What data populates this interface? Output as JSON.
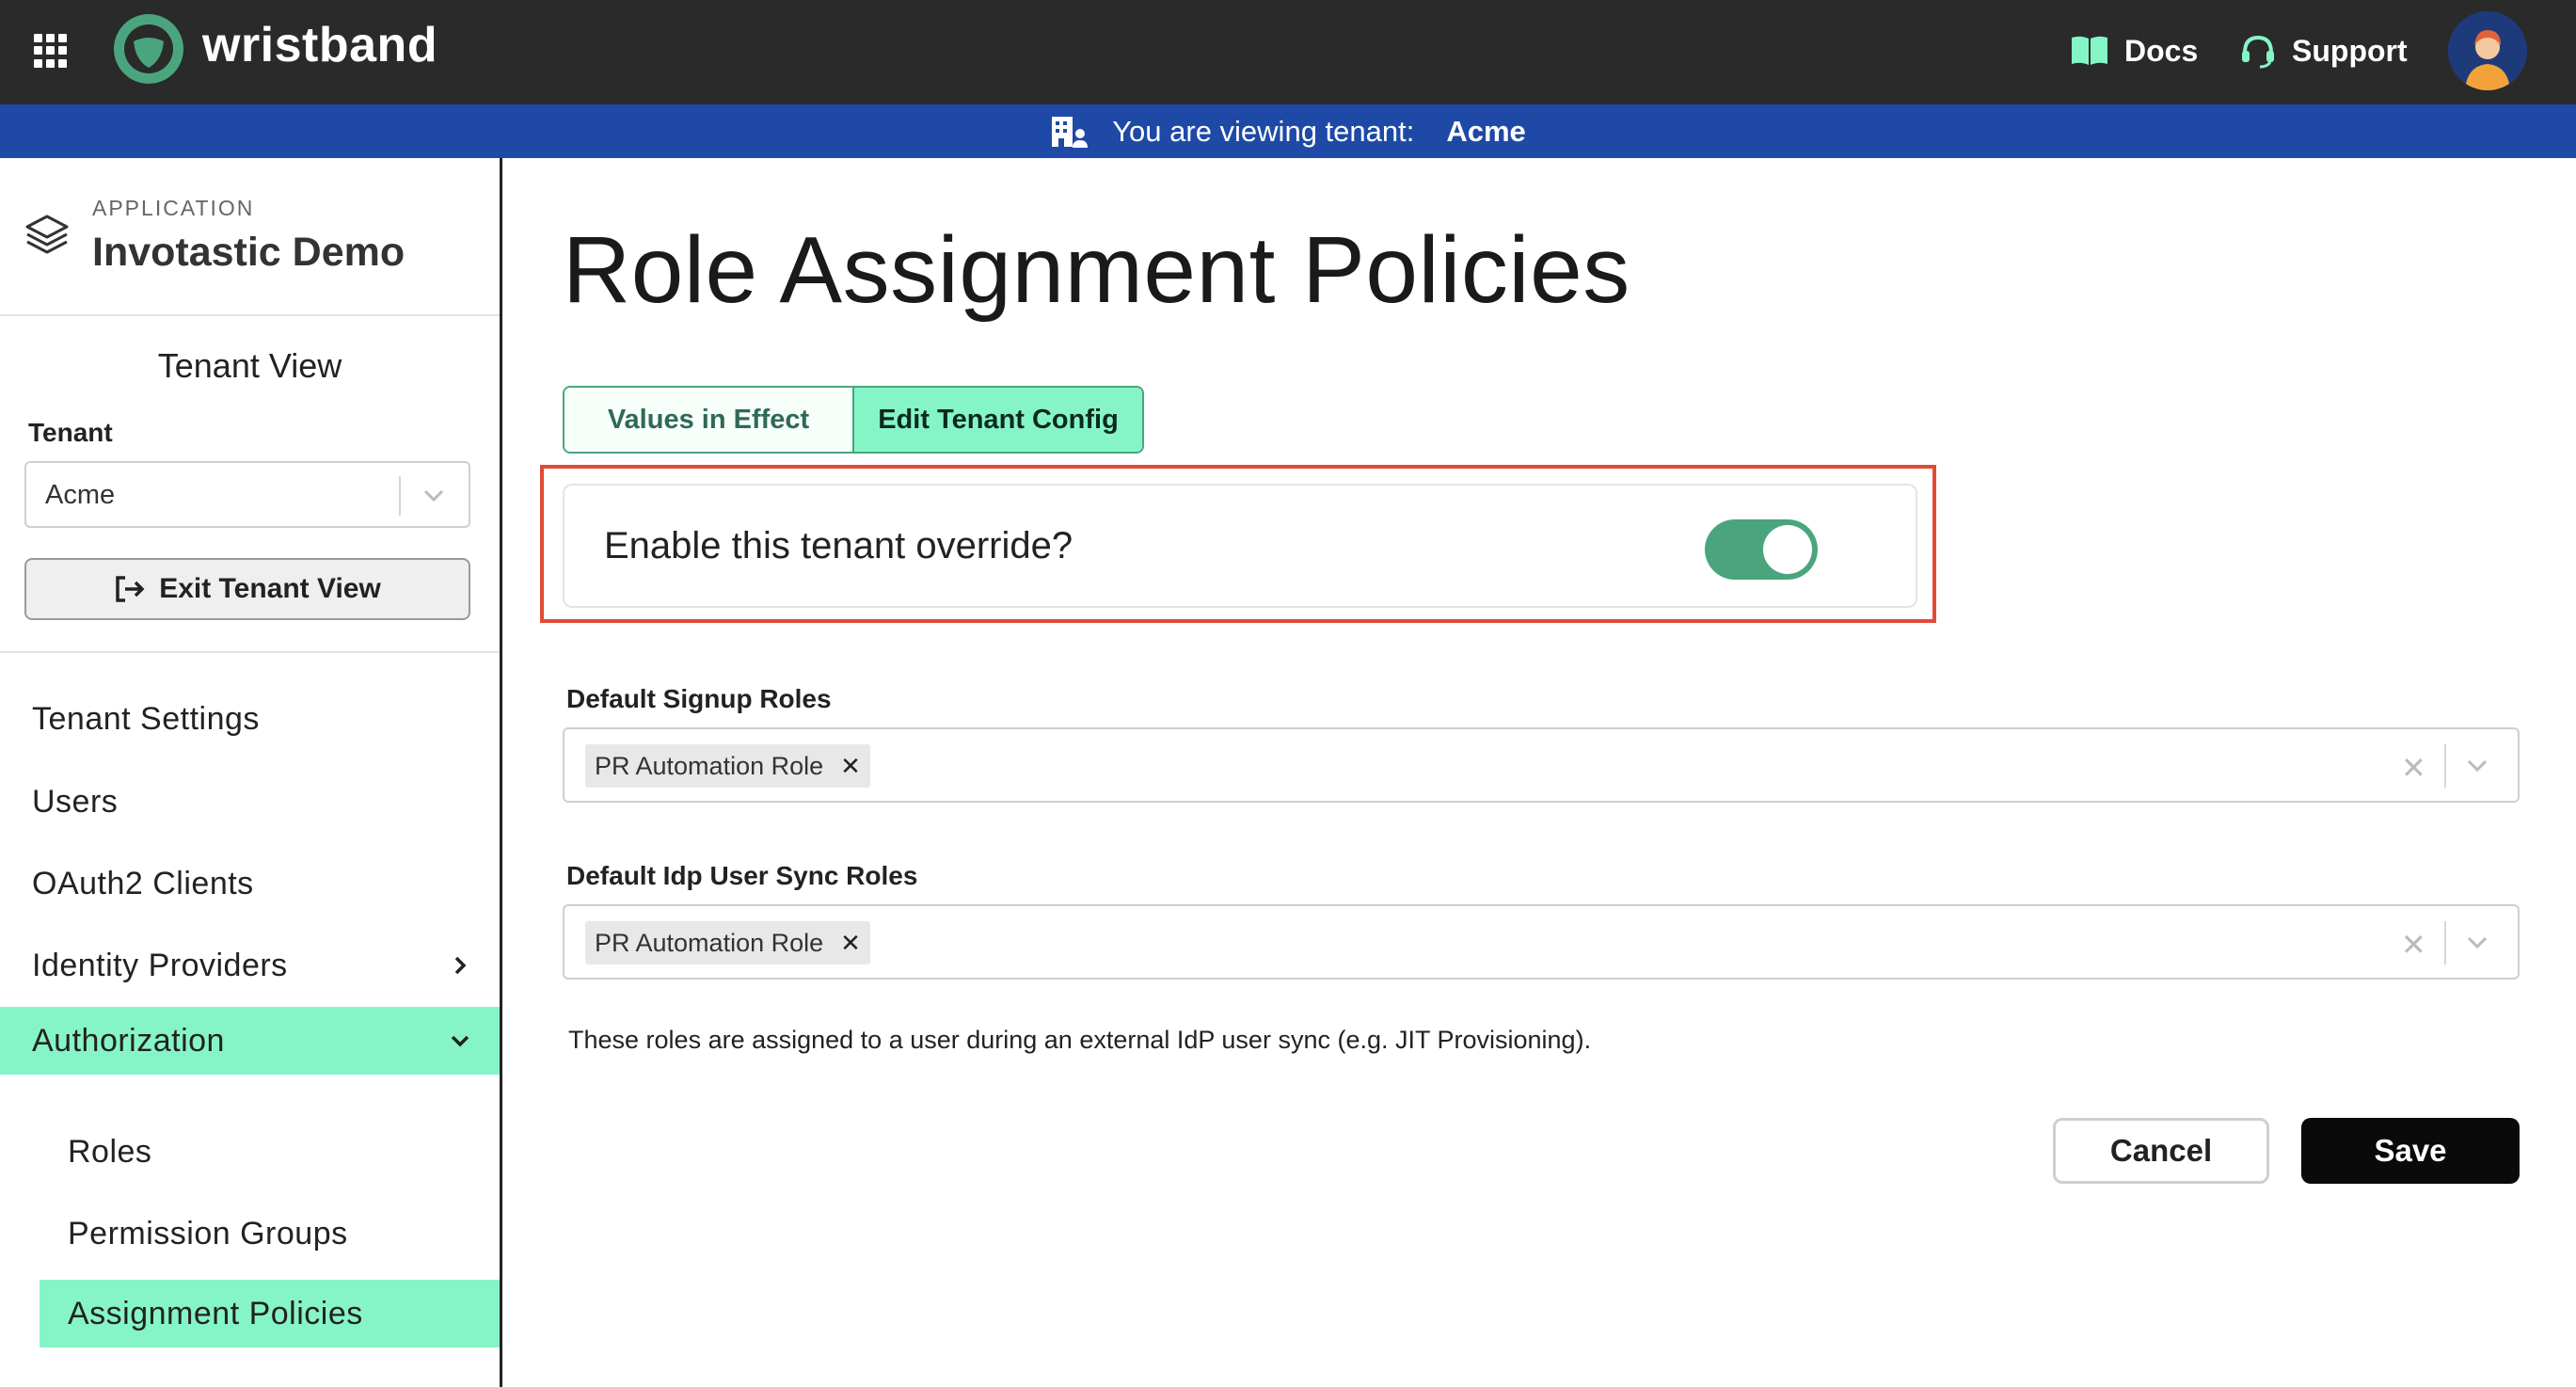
{
  "topbar": {
    "brand": "wristband",
    "docs_label": "Docs",
    "support_label": "Support",
    "icons": [
      "apps-grid-icon",
      "wristband-logo",
      "book-icon",
      "headset-icon",
      "user-avatar"
    ],
    "background": "#2a2a2a"
  },
  "banner": {
    "text": "You are viewing tenant:",
    "tenant": "Acme",
    "icon": "building-user-icon",
    "background": "#1e49a6"
  },
  "sidebar": {
    "app_caption": "APPLICATION",
    "app_name": "Invotastic Demo",
    "tenant_view_title": "Tenant View",
    "tenant_label": "Tenant",
    "tenant_value": "Acme",
    "exit_label": "Exit Tenant View",
    "items": [
      {
        "label": "Tenant Settings"
      },
      {
        "label": "Users"
      },
      {
        "label": "OAuth2 Clients"
      },
      {
        "label": "Identity Providers"
      },
      {
        "label": "Authorization"
      }
    ],
    "subitems": [
      {
        "label": "Roles"
      },
      {
        "label": "Permission Groups"
      },
      {
        "label": "Assignment Policies"
      }
    ],
    "active_color": "#85f5c8"
  },
  "main": {
    "title": "Role Assignment Policies",
    "tabs": [
      {
        "label": "Values in Effect",
        "selected": false
      },
      {
        "label": "Edit Tenant Config",
        "selected": true
      }
    ],
    "override": {
      "label": "Enable this tenant override?",
      "enabled": true,
      "highlight_color": "#e14a37"
    },
    "fields": [
      {
        "label": "Default Signup Roles",
        "chips": [
          "PR Automation Role"
        ]
      },
      {
        "label": "Default Idp User Sync Roles",
        "chips": [
          "PR Automation Role"
        ]
      }
    ],
    "helper_text": "These roles are assigned to a user during an external IdP user sync (e.g. JIT Provisioning).",
    "cancel_label": "Cancel",
    "save_label": "Save"
  }
}
